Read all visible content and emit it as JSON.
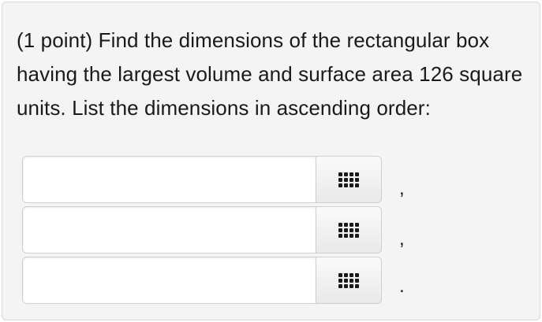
{
  "question": {
    "text": "(1 point) Find the dimensions of the rectangular box having the largest volume and surface area 126 square units. List the dimensions in ascending order:"
  },
  "answers": [
    {
      "value": "",
      "separator": ","
    },
    {
      "value": "",
      "separator": ","
    },
    {
      "value": "",
      "separator": "."
    }
  ],
  "icons": {
    "keypad": "keypad-icon"
  }
}
